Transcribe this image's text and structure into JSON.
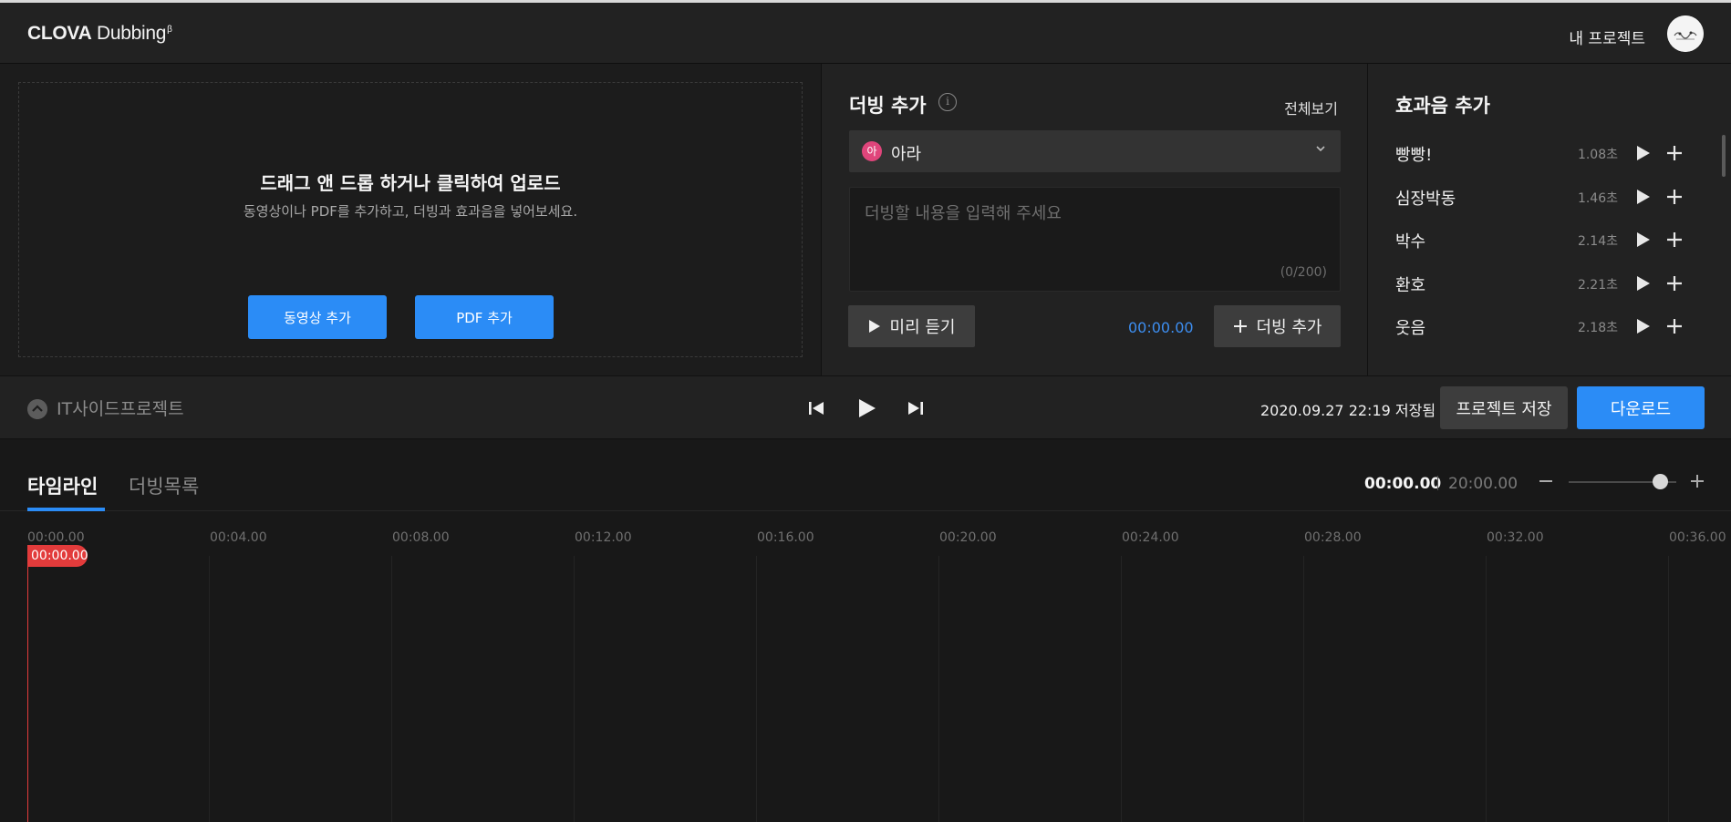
{
  "header": {
    "logo_bold": "CLOVA",
    "logo_rest": "Dubbing",
    "logo_sup": "β",
    "my_projects": "내 프로젝트"
  },
  "upload": {
    "title": "드래그 앤 드롭 하거나 클릭하여 업로드",
    "subtitle": "동영상이나 PDF를 추가하고, 더빙과 효과음을 넣어보세요.",
    "add_video": "동영상 추가",
    "add_pdf": "PDF 추가"
  },
  "dubbing": {
    "title": "더빙 추가",
    "info_glyph": "i",
    "view_all": "전체보기",
    "voice_badge": "아",
    "voice_name": "아라",
    "placeholder": "더빙할 내용을 입력해 주세요",
    "counter": "(0/200)",
    "preview": "미리 듣기",
    "time": "00:00.00",
    "add": "더빙 추가"
  },
  "effects": {
    "title": "효과음 추가",
    "items": [
      {
        "name": "빵빵!",
        "duration": "1.08초"
      },
      {
        "name": "심장박동",
        "duration": "1.46초"
      },
      {
        "name": "박수",
        "duration": "2.14초"
      },
      {
        "name": "환호",
        "duration": "2.21초"
      },
      {
        "name": "웃음",
        "duration": "2.18초"
      }
    ]
  },
  "controls": {
    "project_name": "IT사이드프로젝트",
    "saved_status": "2020.09.27  22:19  저장됨",
    "save_project": "프로젝트 저장",
    "download": "다운로드"
  },
  "timeline": {
    "tab_timeline": "타임라인",
    "tab_dub_list": "더빙목록",
    "current_time": "00:00.00",
    "total_time": "20:00.00",
    "playhead_label": "00:00.00",
    "ruler": [
      "00:00.00",
      "00:04.00",
      "00:08.00",
      "00:12.00",
      "00:16.00",
      "00:20.00",
      "00:24.00",
      "00:28.00",
      "00:32.00",
      "00:36.00"
    ]
  },
  "colors": {
    "accent_blue": "#2b8cf6",
    "playhead_red": "#e23b3b",
    "voice_badge_pink": "#e0457b"
  }
}
